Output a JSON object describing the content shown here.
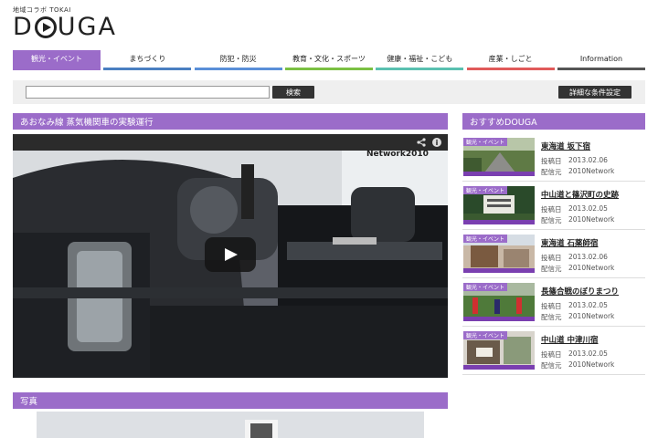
{
  "logo": {
    "sub": "地域コラボ TOKAI",
    "main_left": "D",
    "main_right": "UGA"
  },
  "nav": [
    {
      "label": "観光・イベント",
      "color": "#9b6cc9",
      "active": true
    },
    {
      "label": "まちづくり",
      "color": "#4a7fc1",
      "active": false
    },
    {
      "label": "防犯・防災",
      "color": "#5a8fd8",
      "active": false
    },
    {
      "label": "教育・文化・スポーツ",
      "color": "#7bc043",
      "active": false
    },
    {
      "label": "健康・福祉・こども",
      "color": "#5ac0b0",
      "active": false
    },
    {
      "label": "産業・しごと",
      "color": "#e05a5a",
      "active": false
    },
    {
      "label": "Information",
      "color": "#555555",
      "active": false
    }
  ],
  "search": {
    "value": "",
    "placeholder": "",
    "button": "検索",
    "advanced": "詳細な条件設定"
  },
  "video": {
    "title": "あおなみ線 蒸気機関車の実験運行",
    "watermark": "Network2010"
  },
  "recommend": {
    "title": "おすすめDOUGA",
    "date_label": "投稿日",
    "source_label": "配信元",
    "items": [
      {
        "badge": "観光・イベント",
        "title": "東海道 坂下宿",
        "date": "2013.02.06",
        "source": "2010Network"
      },
      {
        "badge": "観光・イベント",
        "title": "中山道と篠沢町の史跡",
        "date": "2013.02.05",
        "source": "2010Network"
      },
      {
        "badge": "観光・イベント",
        "title": "東海道 石薬師宿",
        "date": "2013.02.06",
        "source": "2010Network"
      },
      {
        "badge": "観光・イベント",
        "title": "長篠合戦のぼりまつり",
        "date": "2013.02.05",
        "source": "2010Network"
      },
      {
        "badge": "観光・イベント",
        "title": "中山道 中津川宿",
        "date": "2013.02.05",
        "source": "2010Network"
      }
    ]
  },
  "photo": {
    "title": "写真"
  },
  "colors": {
    "accent": "#9b6cc9",
    "dark_button": "#333333",
    "search_bg": "#efefef"
  }
}
